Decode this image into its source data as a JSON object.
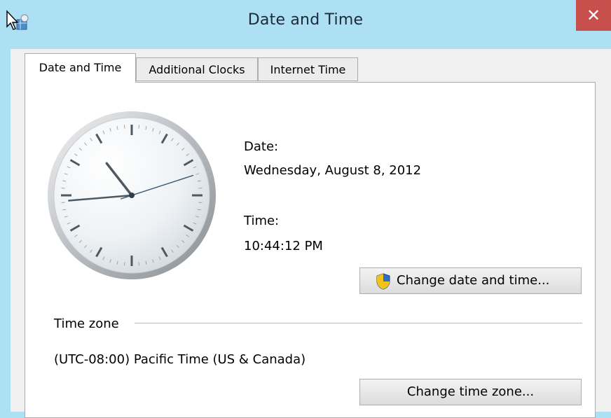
{
  "window": {
    "title": "Date and Time",
    "close_glyph": "✕"
  },
  "tabs": [
    {
      "label": "Date and Time",
      "active": true
    },
    {
      "label": "Additional Clocks",
      "active": false
    },
    {
      "label": "Internet Time",
      "active": false
    }
  ],
  "clock": {
    "hour": 10,
    "minute": 44,
    "second": 12
  },
  "date": {
    "label": "Date:",
    "value": "Wednesday, August 8, 2012"
  },
  "time": {
    "label": "Time:",
    "value": "10:44:12 PM"
  },
  "buttons": {
    "change_date_time": "Change date and time...",
    "change_time_zone": "Change time zone..."
  },
  "time_zone": {
    "legend": "Time zone",
    "value": "(UTC-08:00) Pacific Time (US & Canada)"
  },
  "icons": {
    "app": "date-time-app-icon",
    "shield": "uac-shield-icon",
    "close": "close-icon"
  },
  "colors": {
    "title_bar": "#aee0f4",
    "close_button": "#c7504d",
    "panel": "#ffffff"
  }
}
